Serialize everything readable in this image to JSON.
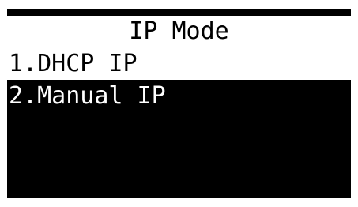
{
  "title": "IP Mode",
  "menu": {
    "items": [
      {
        "label": "1.DHCP IP",
        "selected": true
      },
      {
        "label": "2.Manual IP",
        "selected": false
      }
    ]
  },
  "colors": {
    "background": "#000000",
    "foreground": "#ffffff",
    "highlight": "#ffffff",
    "highlight_text": "#000000"
  }
}
